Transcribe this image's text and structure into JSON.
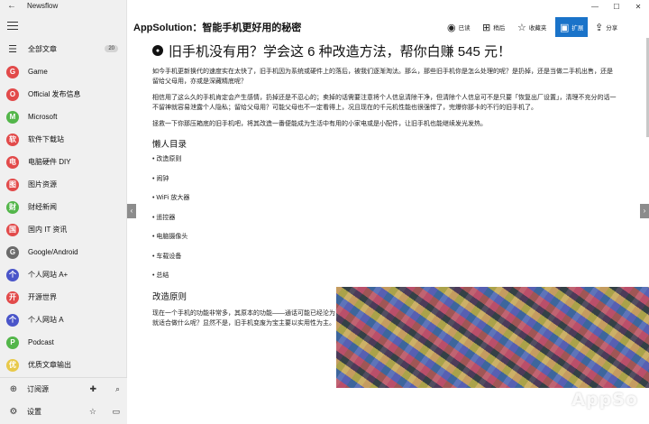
{
  "app": {
    "title": "Newsflow"
  },
  "window": {
    "minimize": "—",
    "maximize": "☐",
    "close": "✕"
  },
  "sidebar": {
    "items": [
      {
        "label": "全部文章",
        "icon": "list-icon",
        "letter": "☰",
        "color": "#333333",
        "count": "20"
      },
      {
        "label": "Game",
        "icon": "feed-icon",
        "letter": "G",
        "color": "#e24a4a"
      },
      {
        "label": "Official 发布信息",
        "icon": "feed-icon",
        "letter": "O",
        "color": "#e24a4a"
      },
      {
        "label": "Microsoft",
        "icon": "feed-icon",
        "letter": "M",
        "color": "#53b64a"
      },
      {
        "label": "软件下载站",
        "icon": "feed-icon",
        "letter": "软",
        "color": "#e24a4a"
      },
      {
        "label": "电脑硬件 DIY",
        "icon": "feed-icon",
        "letter": "电",
        "color": "#e24a4a"
      },
      {
        "label": "图片资源",
        "icon": "feed-icon",
        "letter": "图",
        "color": "#e24a4a"
      },
      {
        "label": "财经新闻",
        "icon": "feed-icon",
        "letter": "财",
        "color": "#53b64a"
      },
      {
        "label": "国内 IT 资讯",
        "icon": "feed-icon",
        "letter": "国",
        "color": "#e24a4a"
      },
      {
        "label": "Google/Android",
        "icon": "feed-icon",
        "letter": "G",
        "color": "#6b6b6b"
      },
      {
        "label": "个人网站 A+",
        "icon": "feed-icon",
        "letter": "个",
        "color": "#4a55c9"
      },
      {
        "label": "开源世界",
        "icon": "feed-icon",
        "letter": "开",
        "color": "#e24a4a"
      },
      {
        "label": "个人网站 A",
        "icon": "feed-icon",
        "letter": "个",
        "color": "#4a55c9"
      },
      {
        "label": "Podcast",
        "icon": "feed-icon",
        "letter": "P",
        "color": "#53b64a"
      },
      {
        "label": "优质文章输出",
        "icon": "feed-icon",
        "letter": "优",
        "color": "#e8c94a"
      }
    ],
    "bottom": {
      "subscribe": "订阅源",
      "settings": "设置"
    }
  },
  "toolbar": {
    "heading": "AppSolution：智能手机更好用的秘密",
    "read": "已读",
    "tag": "稍后",
    "favorite": "收藏夹",
    "expand": "扩展",
    "share": "分享"
  },
  "article": {
    "title": "旧手机没有用？学会这 6 种改造方法，帮你白赚 545 元！",
    "paragraphs": [
      "如今手机更新换代的速度实在太快了，旧手机因为系统或硬件上的落后，被我们逐渐淘汰。那么，那些旧手机你是怎么处理的呢？是扔掉，还是当做二手机出售，还是留给父母用，亦或是深藏精底呢？",
      "相信用了这么久的手机肯定会产生感情，扔掉还是不忍心的；卖掉的话需要注意将个人信息清除干净，但清除个人信息可不是只要「恢复出厂设置」，清理不充分的话一不留神就容易泄露个人隐私；留给父母用？可能父母也不一定看得上，况且现在的千元机性能也很强悍了，完爆你那卡的不行的旧手机了。",
      "拯救一下你那压箱底的旧手机吧，将其改造一番便能成为生活中有用的小家电或是小配件，让旧手机也能继续发光发热。"
    ],
    "toc_heading": "懒人目录",
    "toc": [
      "改造原则",
      "闹钟",
      "WiFi 放大器",
      "遥控器",
      "电脑摄像头",
      "车载设备",
      "总结"
    ],
    "section_heading": "改造原则",
    "section_para": "现在一个手机的功能非常多，其原本的功能——通话可能已经沦为了附属，因此旧手机即便不插 Sim 卡，光靠 WiFi，也能做许许多多的事。但是不是旧手机有什么功能就适合做什么呢？显然不是，旧手机变废为宝主要以实用性为主。",
    "watermark": "AppSo"
  },
  "nav": {
    "prev": "‹",
    "next": "›"
  }
}
